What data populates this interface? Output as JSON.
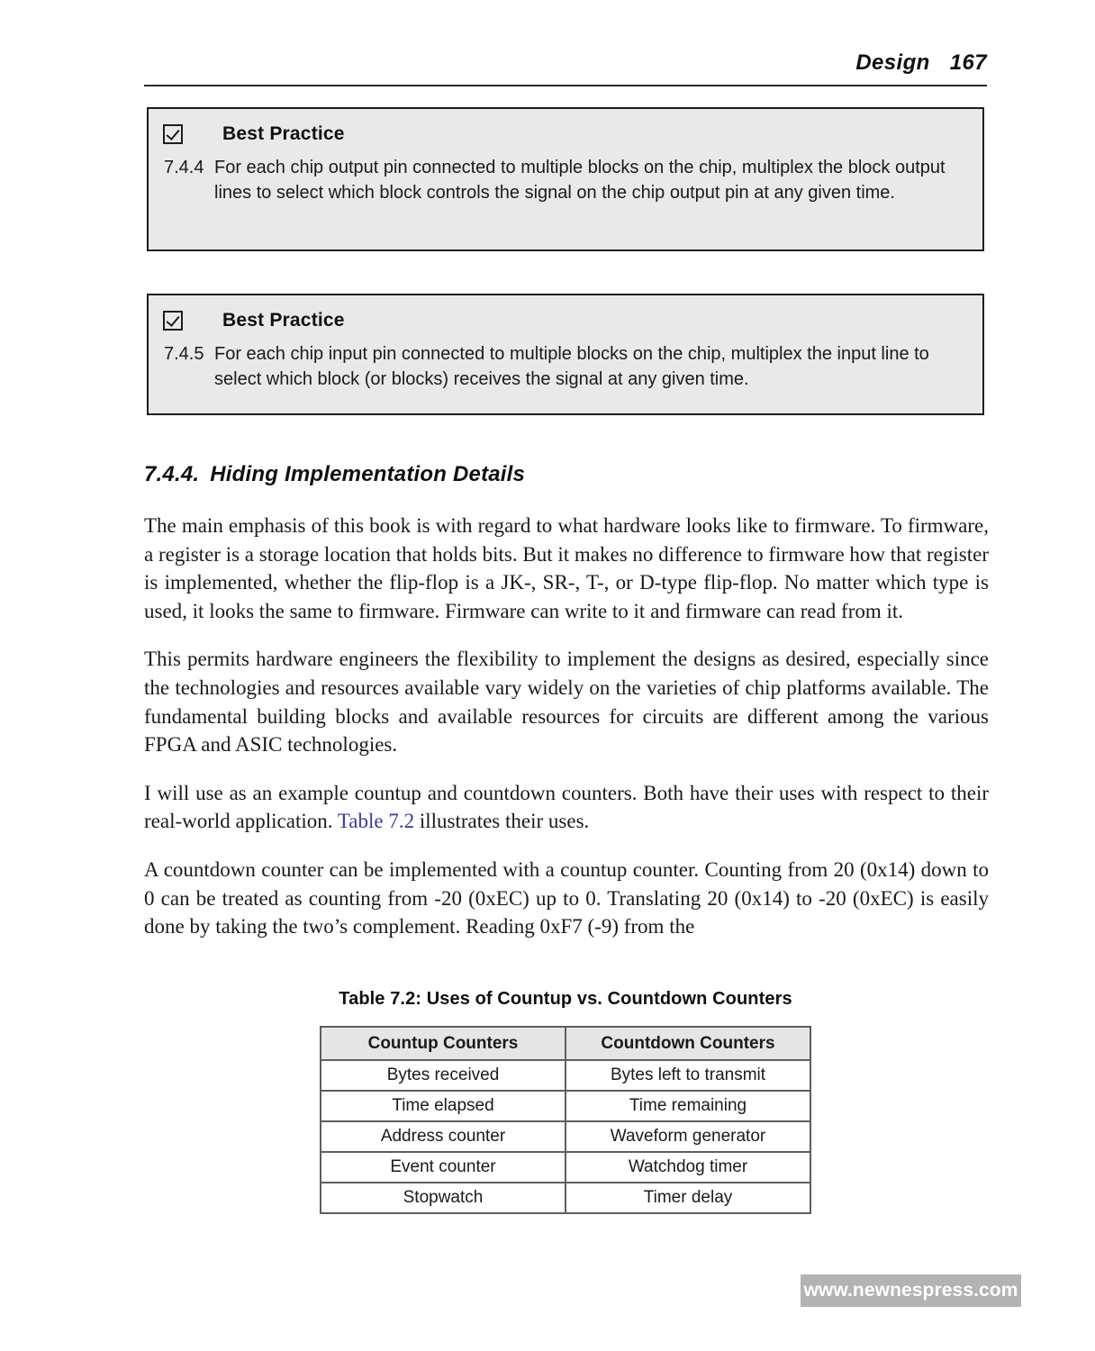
{
  "header": {
    "title": "Design",
    "page_number": "167"
  },
  "best_practice_boxes": [
    {
      "icon": "checked-checkbox-icon",
      "title": "Best Practice",
      "number": "7.4.4",
      "text": "For each chip output pin connected to multiple blocks on the chip, multiplex the block output lines to select which block controls the signal on the chip output pin at any given time."
    },
    {
      "icon": "checked-checkbox-icon",
      "title": "Best Practice",
      "number": "7.4.5",
      "text": "For each chip input pin connected to multiple blocks on the chip, multiplex the input line to select which block (or blocks) receives the signal at any given time."
    }
  ],
  "section": {
    "number": "7.4.4.",
    "title": "Hiding Implementation Details"
  },
  "paragraphs": {
    "p1": "The main emphasis of this book is with regard to what hardware looks like to firmware. To firmware, a register is a storage location that holds bits. But it makes no difference to firmware how that register is implemented, whether the flip-flop is a JK-, SR-, T-, or D-type flip-flop. No matter which type is used, it looks the same to firmware. Firmware can write to it and firmware can read from it.",
    "p2": "This permits hardware engineers the flexibility to implement the designs as desired, especially since the technologies and resources available vary widely on the varieties of chip platforms available. The fundamental building blocks and available resources for circuits are different among the various FPGA and ASIC technologies.",
    "p3_before": "I will use as an example countup and countdown counters. Both have their uses with respect to their real-world application. ",
    "p3_link": "Table 7.2",
    "p3_after": " illustrates their uses.",
    "p4": "A countdown counter can be implemented with a countup counter. Counting from 20 (0x14) down to 0 can be treated as counting from -20 (0xEC) up to 0. Translating 20 (0x14) to -20 (0xEC) is easily done by taking the two’s complement. Reading 0xF7 (-9) from the"
  },
  "table": {
    "caption": "Table 7.2: Uses of Countup vs. Countdown Counters",
    "headers": [
      "Countup Counters",
      "Countdown Counters"
    ],
    "rows": [
      [
        "Bytes received",
        "Bytes left to transmit"
      ],
      [
        "Time elapsed",
        "Time remaining"
      ],
      [
        "Address counter",
        "Waveform generator"
      ],
      [
        "Event counter",
        "Watchdog timer"
      ],
      [
        "Stopwatch",
        "Timer delay"
      ]
    ]
  },
  "footer": {
    "website": "www.newnespress.com"
  },
  "colors": {
    "xref_link": "#3a3a9e",
    "box_fill": "#e9e9e9",
    "table_header_fill": "#e5e5e5",
    "footer_badge_fill": "#b3b3b3"
  }
}
